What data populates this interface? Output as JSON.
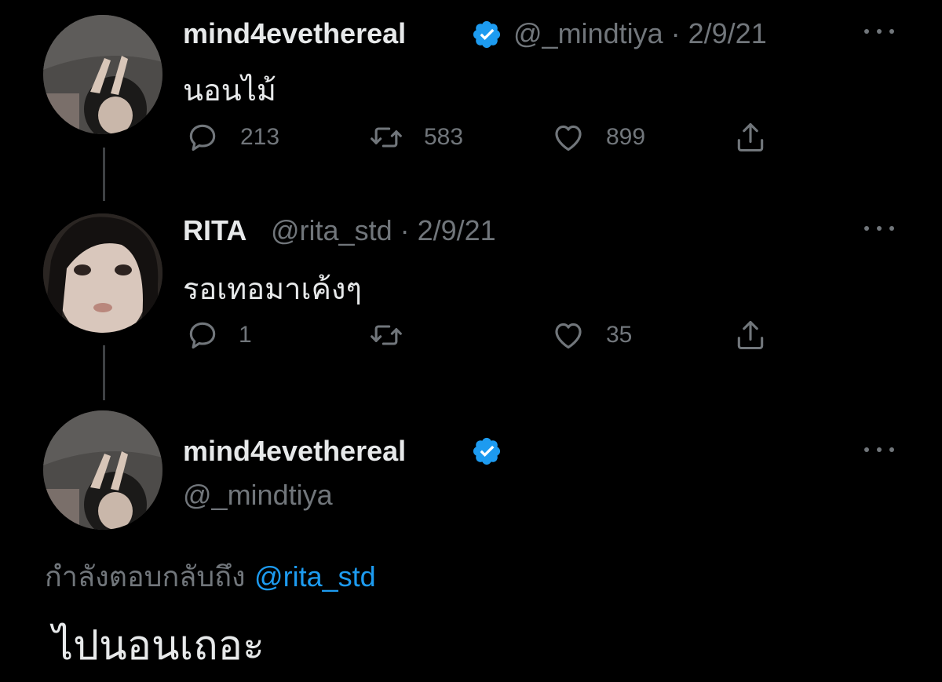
{
  "tweets": [
    {
      "display_name": "mind4evethereal",
      "verified": true,
      "handle": "@_mindtiya",
      "date": "2/9/21",
      "text": "นอนไม้",
      "replies": "213",
      "retweets": "583",
      "likes": "899"
    },
    {
      "display_name": "RITA",
      "verified": false,
      "handle": "@rita_std",
      "date": "2/9/21",
      "text": "รอเทอมาเค้งๆ",
      "replies": "1",
      "retweets": "",
      "likes": "35"
    }
  ],
  "main_tweet": {
    "display_name": "mind4evethereal",
    "verified": true,
    "handle": "@_mindtiya",
    "replying_label": "กำลังตอบกลับถึง",
    "replying_to": "@rita_std",
    "text": "ไปนอนเถอะ"
  },
  "colors": {
    "background": "#000000",
    "text": "#e7e9ea",
    "muted": "#71767b",
    "accent": "#1d9bf0",
    "thread_line": "#3e4144"
  },
  "icons": [
    "verified-badge-icon",
    "reply-icon",
    "retweet-icon",
    "like-icon",
    "share-icon",
    "more-icon"
  ]
}
